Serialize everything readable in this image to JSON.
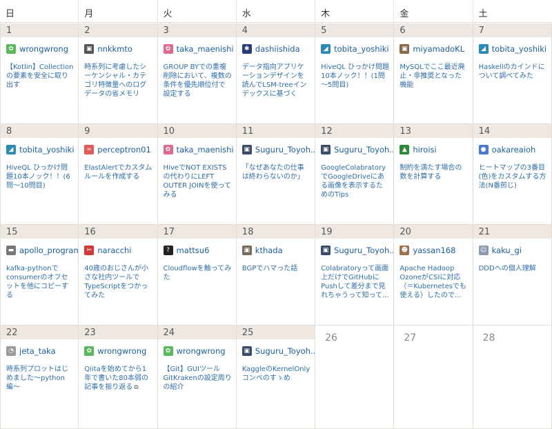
{
  "weekdays": [
    "日",
    "月",
    "火",
    "水",
    "木",
    "金",
    "土"
  ],
  "weeks": [
    [
      {
        "day": "1",
        "user": "wrongwrong",
        "avatar_color": "#5cb85c",
        "avatar_glyph": "✿",
        "title": "【Kotlin】Collectionの要素を安全に取り出す"
      },
      {
        "day": "2",
        "user": "nnkkmto",
        "avatar_color": "#555555",
        "avatar_glyph": "▣",
        "title": "時系列に考慮したシーケンシャル・カテゴリ特徴量へのログデータの省メモリな..."
      },
      {
        "day": "3",
        "user": "taka_maenishi",
        "avatar_color": "#e06a8a",
        "avatar_glyph": "✿",
        "title": "GROUP BYでの重複削除において、複数の条件を優先順位付で設定する"
      },
      {
        "day": "4",
        "user": "dashiishida",
        "avatar_color": "#2b3a7a",
        "avatar_glyph": "✱",
        "title": "データ指向アプリケーションデザインを読んでLSM-treeインデックスに基づくKVS..."
      },
      {
        "day": "5",
        "user": "tobita_yoshiki",
        "avatar_color": "#2a8ab8",
        "avatar_glyph": "◢",
        "title": "HiveQL ひっかけ問題10本ノック！！(1問～5問目)"
      },
      {
        "day": "6",
        "user": "miyamadoKL",
        "avatar_color": "#8a6a4a",
        "avatar_glyph": "▣",
        "title": "MySQLでここ最近廃止・非推奨となった機能"
      },
      {
        "day": "7",
        "user": "tobita_yoshiki",
        "avatar_color": "#2a8ab8",
        "avatar_glyph": "◢",
        "title": "Haskellのカインドについて調べてみた"
      }
    ],
    [
      {
        "day": "8",
        "user": "tobita_yoshiki",
        "avatar_color": "#2a8ab8",
        "avatar_glyph": "◢",
        "title": "HiveQL ひっかけ問題10本ノック！！(6問～10問目)"
      },
      {
        "day": "9",
        "user": "perceptron01",
        "avatar_color": "#e05a5a",
        "avatar_glyph": "∞",
        "title": "ElastAlertでカスタムルールを作成する"
      },
      {
        "day": "10",
        "user": "taka_maenishi",
        "avatar_color": "#e06a8a",
        "avatar_glyph": "✿",
        "title": "HiveでNOT EXISTSの代わりにLEFT OUTER JOINを使ってみる"
      },
      {
        "day": "11",
        "user": "Suguru_Toyoh...",
        "avatar_color": "#3a4a6a",
        "avatar_glyph": "▣",
        "title": "「なぜあなたの仕事は終わらないのか」"
      },
      {
        "day": "12",
        "user": "Suguru_Toyoh...",
        "avatar_color": "#3a4a6a",
        "avatar_glyph": "▣",
        "title": "GoogleColabratoryでGoogleDriveにある画像を表示するためのTips"
      },
      {
        "day": "13",
        "user": "hiroisi",
        "avatar_color": "#2a8a3a",
        "avatar_glyph": "▲",
        "title": "制約を満たす場合の数を計算する"
      },
      {
        "day": "14",
        "user": "oakareaioh",
        "avatar_color": "#4a7ad0",
        "avatar_glyph": "●",
        "title": "ヒートマップの3番目(色)をカスタムする方法(N番煎じ)"
      }
    ],
    [
      {
        "day": "15",
        "user": "apollo_program",
        "avatar_color": "#777777",
        "avatar_glyph": "▬",
        "title": "kafka-pythonでconsumerのオフセットを他にコピーする"
      },
      {
        "day": "16",
        "user": "naracchi",
        "avatar_color": "#d03a3a",
        "avatar_glyph": "✂",
        "title": "40歳のおじさんが小さな社内ツールでTypeScriptをつかってみた"
      },
      {
        "day": "17",
        "user": "mattsu6",
        "avatar_color": "#222222",
        "avatar_glyph": "?",
        "title": "Cloudflowを触ってみた"
      },
      {
        "day": "18",
        "user": "kthada",
        "avatar_color": "#7a6a5a",
        "avatar_glyph": "▣",
        "title": "BGPでハマった話"
      },
      {
        "day": "19",
        "user": "Suguru_Toyoh...",
        "avatar_color": "#3a4a6a",
        "avatar_glyph": "▣",
        "title": "Colabratoryって画面上だけでGitHubにPushして差分まで見れちゃうって知って..."
      },
      {
        "day": "20",
        "user": "yassan168",
        "avatar_color": "#a0704a",
        "avatar_glyph": "☻",
        "title": "Apache Hadoop OzoneがCSIに対応（＝Kubernetesでも使える）したので..."
      },
      {
        "day": "21",
        "user": "kaku_gi",
        "avatar_color": "#8a9ab0",
        "avatar_glyph": "☺",
        "title": "DDDへの個人理解"
      }
    ],
    [
      {
        "day": "22",
        "user": "jeta_taka",
        "avatar_color": "#9a9a9a",
        "avatar_glyph": "◔",
        "title": "時系列プロットはじめました〜python編〜"
      },
      {
        "day": "23",
        "user": "wrongwrong",
        "avatar_color": "#5cb85c",
        "avatar_glyph": "✿",
        "title": "Qiitaを始めてから1年で書いた80本弱の記事を振り返る",
        "external": "⧉"
      },
      {
        "day": "24",
        "user": "wrongwrong",
        "avatar_color": "#5cb85c",
        "avatar_glyph": "✿",
        "title": "【Git】GUIツールGitKrakenの設定周りの紹介"
      },
      {
        "day": "25",
        "user": "Suguru_Toyoh...",
        "avatar_color": "#3a4a6a",
        "avatar_glyph": "▣",
        "title": "KaggleのKernelOnlyコンペのすゝめ"
      },
      {
        "day": "26"
      },
      {
        "day": "27"
      },
      {
        "day": "28"
      }
    ]
  ]
}
